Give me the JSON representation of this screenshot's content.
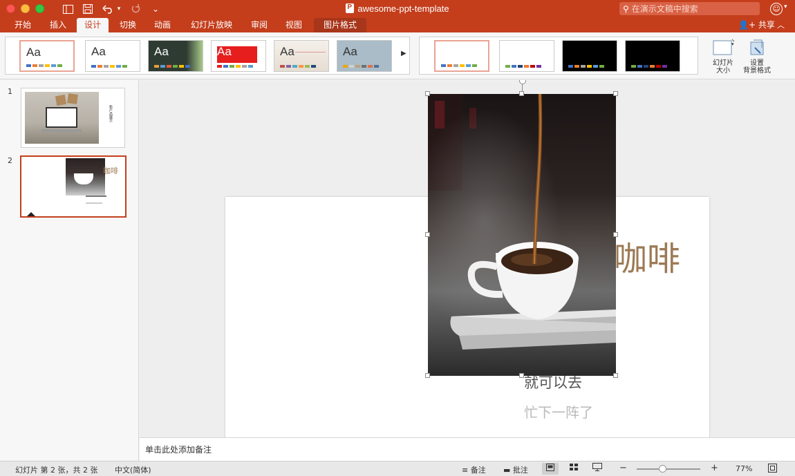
{
  "window": {
    "title": "awesome-ppt-template",
    "search_placeholder": "在演示文稿中搜索"
  },
  "quick_access": {
    "undo_caret": "▾",
    "customize": "⌄"
  },
  "ribbon_tabs": [
    "开始",
    "插入",
    "设计",
    "切换",
    "动画",
    "幻灯片放映",
    "审阅",
    "视图",
    "图片格式"
  ],
  "active_tab": "设计",
  "share_label": "共享",
  "themes": [
    {
      "label": "Aa",
      "bg": "#ffffff",
      "text": "#333333",
      "colors": [
        "#4472c4",
        "#ed7d31",
        "#a5a5a5",
        "#ffc000",
        "#5b9bd5",
        "#70ad47"
      ]
    },
    {
      "label": "Aa",
      "bg": "#ffffff",
      "text": "#333333",
      "colors": [
        "#4472c4",
        "#ed7d31",
        "#a5a5a5",
        "#ffc000",
        "#5b9bd5",
        "#70ad47"
      ]
    },
    {
      "label": "Aa",
      "bg": "#2e3b32",
      "text": "#ffffff",
      "colors": [
        "#e59f3a",
        "#5b9bd5",
        "#e85a3a",
        "#70ad47",
        "#ffc000",
        "#4472c4"
      ]
    },
    {
      "label": "Aa",
      "bg": "#ffffff",
      "text": "#ffffff",
      "colors": [
        "#e61e1e",
        "#4472c4",
        "#70ad47",
        "#ffc000",
        "#a5a5a5",
        "#5b9bd5"
      ]
    },
    {
      "label": "Aa",
      "bg": "#efeae4",
      "text": "#333333",
      "colors": [
        "#c0504d",
        "#8064a2",
        "#4bacc6",
        "#f79646",
        "#9bbb59",
        "#1f497d"
      ]
    },
    {
      "label": "Aa",
      "bg": "#a9bcc7",
      "text": "#333333",
      "colors": [
        "#f0a30a",
        "#d1d1d1",
        "#c0a080",
        "#707070",
        "#e07050",
        "#507090"
      ]
    }
  ],
  "variants": [
    {
      "bg": "#ffffff",
      "colors": [
        "#4472c4",
        "#ed7d31",
        "#a5a5a5",
        "#ffc000",
        "#5b9bd5",
        "#70ad47"
      ]
    },
    {
      "bg": "#ffffff",
      "colors": [
        "#70ad47",
        "#4472c4",
        "#264478",
        "#ed7d31",
        "#c00000",
        "#7030a0"
      ]
    },
    {
      "bg": "#000000",
      "colors": [
        "#4472c4",
        "#ed7d31",
        "#a5a5a5",
        "#ffc000",
        "#5b9bd5",
        "#70ad47"
      ]
    },
    {
      "bg": "#000000",
      "colors": [
        "#70ad47",
        "#4472c4",
        "#264478",
        "#ed7d31",
        "#c00000",
        "#7030a0"
      ]
    }
  ],
  "ribbon_buttons": {
    "slide_size": [
      "幻灯片",
      "大小"
    ],
    "format_background": [
      "设置",
      "背景格式"
    ]
  },
  "slides_panel": [
    {
      "number": "1",
      "caption": "新产品展示"
    },
    {
      "number": "2",
      "caption": "咖啡"
    }
  ],
  "slide": {
    "title": "咖啡",
    "subtitle_line1": "就可以去",
    "subtitle_line2": "忙下一阵了"
  },
  "notes_placeholder": "单击此处添加备注",
  "status_bar": {
    "slide_position": "幻灯片 第 2 张，共 2 张",
    "language": "中文(简体)",
    "notes_label": "备注",
    "comments_label": "批注",
    "zoom_minus": "−",
    "zoom_plus": "+",
    "zoom_level": "77%"
  }
}
